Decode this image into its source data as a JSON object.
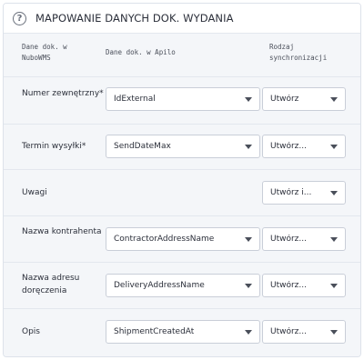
{
  "header": {
    "title": "MAPOWANIE DANYCH DOK. WYDANIA",
    "help_icon": "?"
  },
  "columns": {
    "nubo": "Dane dok. w NuboWMS",
    "apilo": "Dane dok. w Apilo",
    "sync": "Rodzaj synchronizacji"
  },
  "rows": [
    {
      "label": "Numer zewnętrzny*",
      "field": "IdExternal",
      "sync": "Utwórz"
    },
    {
      "label": "Termin wysyłki*",
      "field": "SendDateMax",
      "sync": "Utwórz..."
    },
    {
      "label": "Uwagi",
      "field": "",
      "sync": "Utwórz i..."
    },
    {
      "label": "Nazwa kontrahenta",
      "field": "ContractorAddressName",
      "sync": "Utwórz..."
    },
    {
      "label": "Nazwa adresu doręczenia",
      "field": "DeliveryAddressName",
      "sync": "Utwórz..."
    },
    {
      "label": "Opis",
      "field": "ShipmentCreatedAt",
      "sync": "Utwórz..."
    }
  ]
}
